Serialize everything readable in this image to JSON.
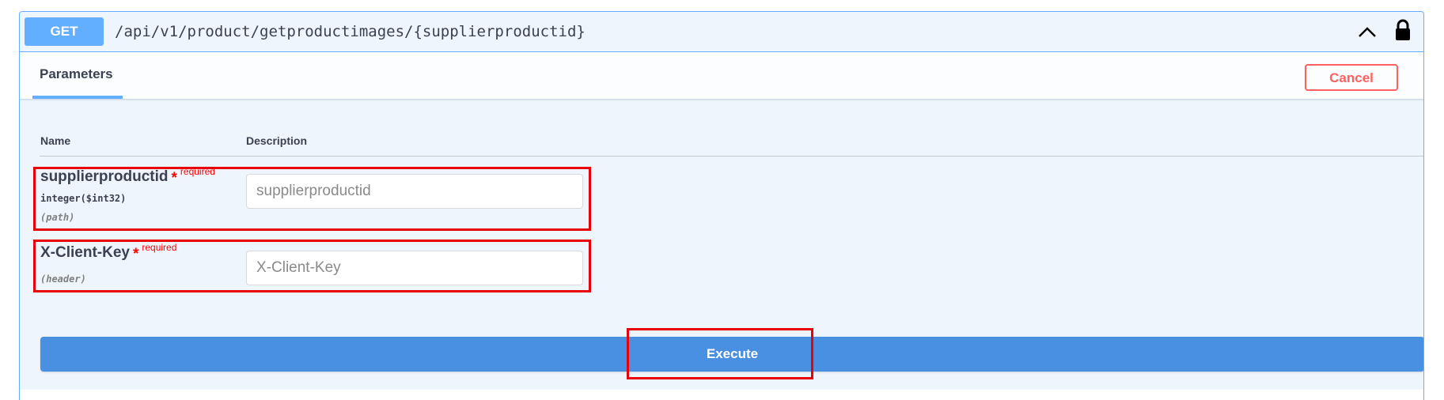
{
  "operation": {
    "method": "GET",
    "path": "/api/v1/product/getproductimages/{supplierproductid}"
  },
  "section": {
    "tab_label": "Parameters",
    "cancel_label": "Cancel"
  },
  "table": {
    "col_name": "Name",
    "col_description": "Description"
  },
  "parameters": [
    {
      "name": "supplierproductid",
      "required_star": "*",
      "required_label": "required",
      "type": "integer($int32)",
      "in": "(path)",
      "placeholder": "supplierproductid"
    },
    {
      "name": "X-Client-Key",
      "required_star": "*",
      "required_label": "required",
      "in": "(header)",
      "placeholder": "X-Client-Key"
    }
  ],
  "execute_label": "Execute",
  "colors": {
    "get_method": "#61affe",
    "cancel": "#ff6060",
    "execute": "#4990e2",
    "highlight": "#e8000b"
  },
  "icons": {
    "collapse": "chevron-up-icon",
    "auth": "lock-icon"
  }
}
